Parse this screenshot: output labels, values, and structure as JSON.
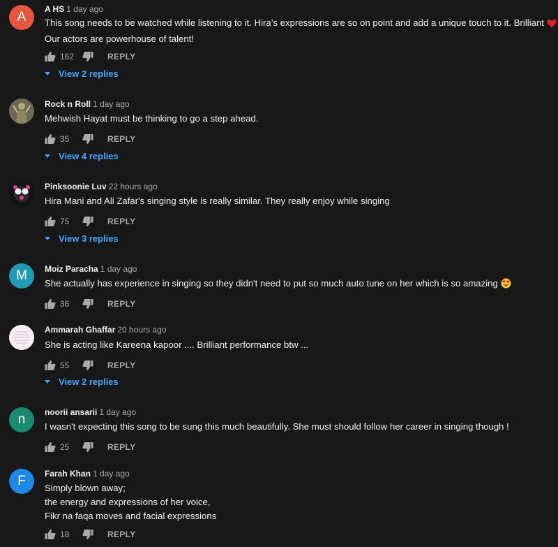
{
  "comments": [
    {
      "author": "A HS",
      "time": "1 day ago",
      "avatar_letter": "A",
      "avatar_color": "#e8553f",
      "lines": [
        "This song needs to be watched while listening to it. Hira’s expressions are so on point and add a unique touch to it. Brilliant",
        "Our actors are powerhouse of talent!"
      ],
      "likes": "162",
      "reply_label": "REPLY",
      "view_replies": "View 2 replies"
    },
    {
      "author": "Rock n Roll",
      "time": "1 day ago",
      "avatar_letter": "",
      "lines": [
        "Mehwish Hayat must be thinking to go a step ahead."
      ],
      "likes": "35",
      "reply_label": "REPLY",
      "view_replies": "View 4 replies"
    },
    {
      "author": "Pinksoonie Luv",
      "time": "22 hours ago",
      "avatar_letter": "",
      "lines": [
        "Hira Mani and Ali Zafar's singing style is really similar. They really enjoy while singing"
      ],
      "likes": "75",
      "reply_label": "REPLY",
      "view_replies": "View 3 replies"
    },
    {
      "author": "Moiz Paracha",
      "time": "1 day ago",
      "avatar_letter": "M",
      "avatar_color": "#1f9bb6",
      "lines": [
        "She actually has experience in singing so they didn't need to put so much auto tune on her which is so amazing"
      ],
      "likes": "36",
      "reply_label": "REPLY"
    },
    {
      "author": "Ammarah Ghaffar",
      "time": "20 hours ago",
      "avatar_letter": "",
      "lines": [
        "She is acting like Kareena kapoor .... Brilliant performance btw ..."
      ],
      "likes": "55",
      "reply_label": "REPLY",
      "view_replies": "View 2 replies"
    },
    {
      "author": "noorii ansarii",
      "time": "1 day ago",
      "avatar_letter": "n",
      "avatar_color": "#1b8a72",
      "lines": [
        "I wasn't expecting this song to be sung this much beautifully. She must should follow her career in singing though !"
      ],
      "likes": "25",
      "reply_label": "REPLY"
    },
    {
      "author": "Farah Khan",
      "time": "1 day ago",
      "avatar_letter": "F",
      "avatar_color": "#1e88e5",
      "lines": [
        "Simply blown away;",
        "the energy and expressions of her voice,",
        "Fikr na faqa moves and facial expressions"
      ],
      "likes": "18",
      "reply_label": "REPLY"
    }
  ],
  "icons": {
    "like": "thumbs-up-icon",
    "dislike": "thumbs-down-icon",
    "heart": "red-heart-emoji",
    "heart_eyes": "heart-eyes-emoji",
    "chevron": "chevron-down-icon"
  },
  "colors": {
    "background": "#181818",
    "text": "#f1f1f1",
    "secondary": "#aaaaaa",
    "link": "#3ea6ff"
  }
}
